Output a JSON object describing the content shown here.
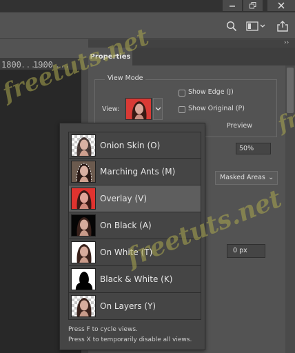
{
  "colors": {
    "panel_bg": "#535353",
    "dark_bg": "#323232",
    "canvas_bg": "#282828",
    "dropdown_bg": "#454545",
    "selected_row": "#5e5e5e",
    "overlay_red": "#e23b3b",
    "watermark": "#aca84e"
  },
  "window_controls": {
    "minimize_icon": "minimize-icon",
    "maximize_icon": "restore-icon",
    "close_icon": "close-icon"
  },
  "toolbar": {
    "icons": [
      "search-icon",
      "workspace-icon",
      "share-icon"
    ]
  },
  "ruler": {
    "marks": [
      "1800",
      "1900"
    ]
  },
  "panel": {
    "tab_label": "Properties",
    "collapse_glyph": "››",
    "view_mode": {
      "title": "View Mode",
      "view_label": "View:",
      "show_edge_label": "Show Edge (J)",
      "show_original_label": "Show Original (P)",
      "preview_label": "Preview"
    },
    "opacity_value": "50%",
    "masked_select_value": "Masked Areas",
    "radius_value": "0 px"
  },
  "dropdown": {
    "items": [
      {
        "label": "Onion Skin (O)",
        "thumb": "onion-skin"
      },
      {
        "label": "Marching Ants (M)",
        "thumb": "marching-ants"
      },
      {
        "label": "Overlay (V)",
        "thumb": "overlay"
      },
      {
        "label": "On Black (A)",
        "thumb": "on-black"
      },
      {
        "label": "On White (T)",
        "thumb": "on-white"
      },
      {
        "label": "Black & White (K)",
        "thumb": "black-white"
      },
      {
        "label": "On Layers (Y)",
        "thumb": "on-layers"
      }
    ],
    "selected_index": 2,
    "hint_1": "Press F to cycle views.",
    "hint_2": "Press X to temporarily disable all views."
  },
  "watermark_text": "freetuts.net"
}
